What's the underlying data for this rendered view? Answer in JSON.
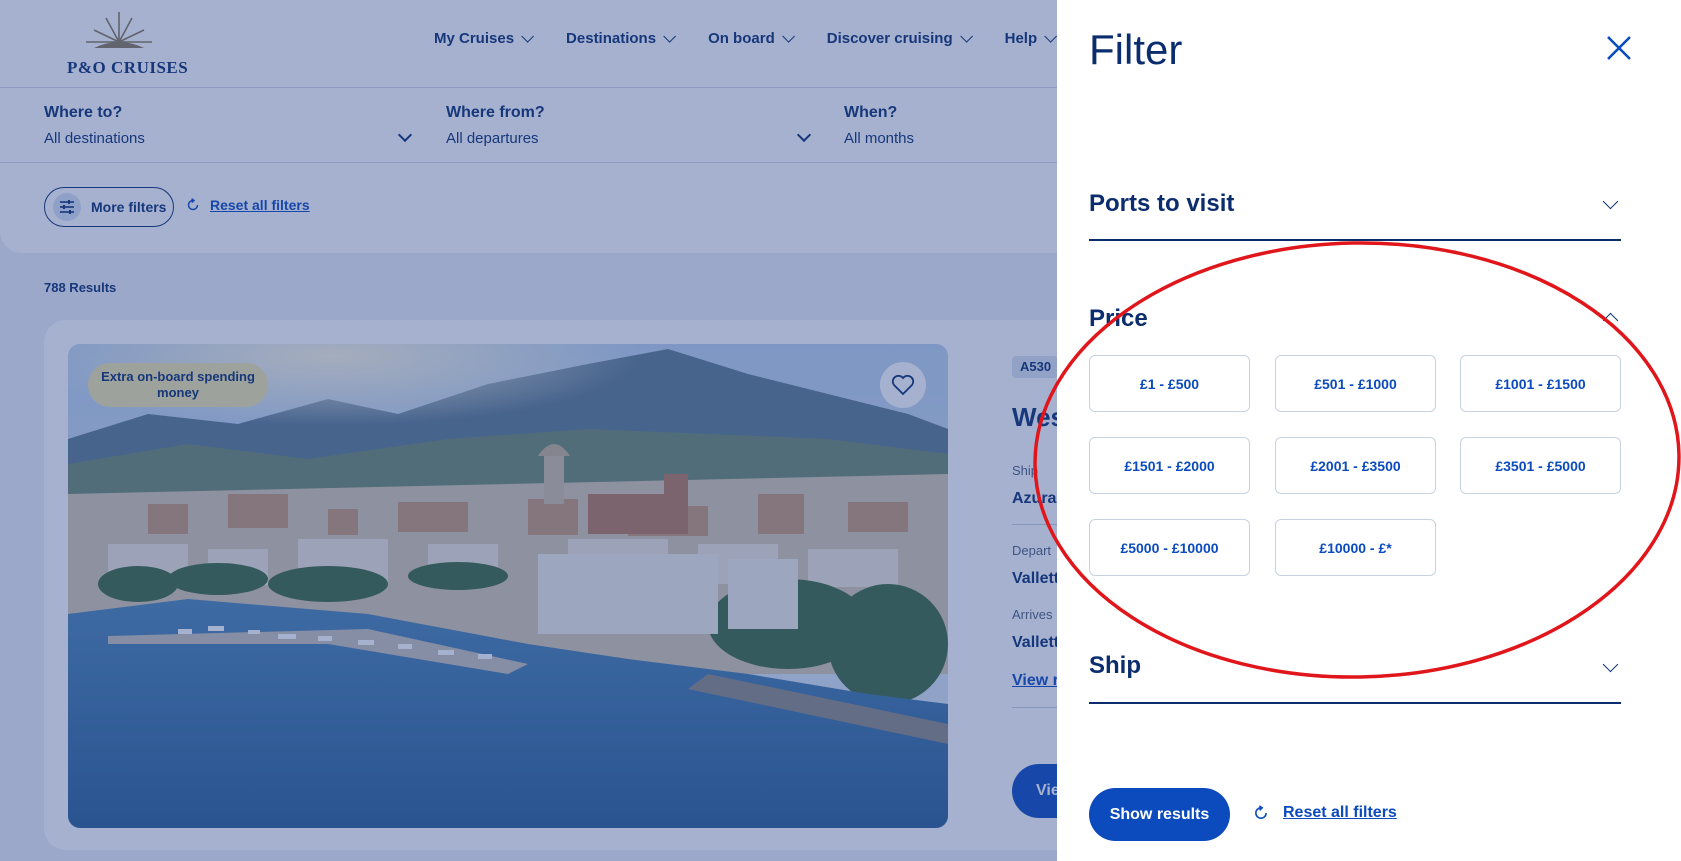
{
  "brand": {
    "name": "P&O CRUISES"
  },
  "nav": {
    "items": [
      {
        "label": "My Cruises"
      },
      {
        "label": "Destinations"
      },
      {
        "label": "On board"
      },
      {
        "label": "Discover cruising"
      },
      {
        "label": "Help"
      }
    ]
  },
  "search": {
    "where_to": {
      "label": "Where to?",
      "value": "All destinations"
    },
    "where_from": {
      "label": "Where from?",
      "value": "All departures"
    },
    "when": {
      "label": "When?",
      "value": "All months"
    }
  },
  "filters_bar": {
    "more_filters_label": "More filters",
    "reset_label": "Reset all filters"
  },
  "results": {
    "count_label": "788 Results"
  },
  "card": {
    "badge_text": "Extra on-board spending money",
    "code": "A530",
    "title_partial": "Wes",
    "ship_label": "Ship",
    "ship_value": "Azura",
    "depart_label": "Depart",
    "depart_value": "Vallett",
    "arrives_label": "Arrives",
    "arrives_value": "Vallett",
    "view_link": "View r",
    "view_button": "Vie"
  },
  "drawer": {
    "title": "Filter",
    "sections": {
      "ports": {
        "title": "Ports to visit",
        "expanded": false
      },
      "price": {
        "title": "Price",
        "expanded": true
      },
      "ship": {
        "title": "Ship",
        "expanded": false
      }
    },
    "price_options": [
      "£1 - £500",
      "£501 - £1000",
      "£1001 - £1500",
      "£1501 - £2000",
      "£2001 - £3500",
      "£3501 - £5000",
      "£5000 - £10000",
      "£10000 - £*"
    ],
    "show_results_label": "Show results",
    "reset_label": "Reset all filters"
  },
  "colors": {
    "navy": "#0b2d6e",
    "link_blue": "#0b4bbd",
    "overlay": "#28468c",
    "annotation_red": "#e0161b",
    "badge_yellow": "#f2e5a8"
  },
  "icons": {
    "close": "close-icon",
    "chevron": "chevron-down-icon",
    "reset": "refresh-icon",
    "filters": "sliders-icon",
    "favorite": "heart-icon"
  }
}
